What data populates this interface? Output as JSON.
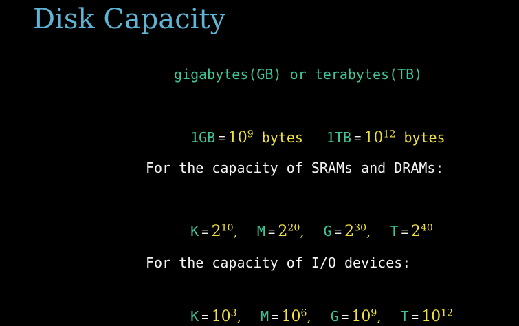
{
  "slide": {
    "title": "Disk Capacity"
  },
  "units_line": "gigabytes(GB) or terabytes(TB)",
  "gb_tb": {
    "gb_label": "1GB",
    "eq": "=",
    "gb_base": "10",
    "gb_exp": "9",
    "gb_unit": "bytes",
    "tb_label": "1TB",
    "tb_base": "10",
    "tb_exp": "12",
    "tb_unit": "bytes"
  },
  "sram_heading": "For the capacity of SRAMs and DRAMs:",
  "sram": {
    "k_label": "K",
    "k_base": "2",
    "k_exp": "10",
    "m_label": "M",
    "m_base": "2",
    "m_exp": "20",
    "g_label": "G",
    "g_base": "2",
    "g_exp": "30",
    "t_label": "T",
    "t_base": "2",
    "t_exp": "40",
    "comma": ","
  },
  "io_heading": "For the capacity of I/O devices:",
  "io": {
    "k_label": "K",
    "k_base": "10",
    "k_exp": "3",
    "m_label": "M",
    "m_base": "10",
    "m_exp": "6",
    "g_label": "G",
    "g_base": "10",
    "g_exp": "9",
    "t_label": "T",
    "t_base": "10",
    "t_exp": "12",
    "comma": ","
  },
  "colors": {
    "background": "#000000",
    "title": "#5fb4d6",
    "term": "#3fc59a",
    "value": "#f0e23c",
    "text": "#f4f4f4"
  }
}
